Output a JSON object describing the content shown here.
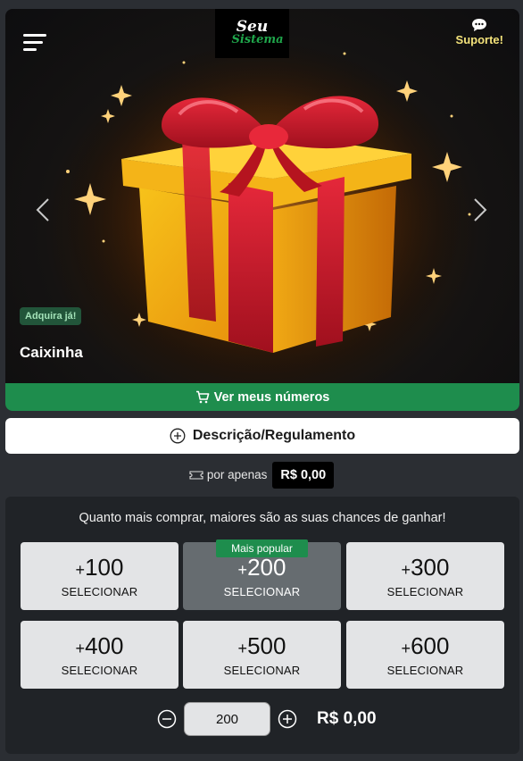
{
  "header": {
    "logo_line1": "Seu",
    "logo_line2": "Sistema",
    "support_label": "Suporte!",
    "menu_icon": "hamburger-icon",
    "support_icon": "chat-bubble-icon"
  },
  "hero": {
    "badge": "Adquira já!",
    "title": "Caixinha",
    "see_numbers_label": "Ver meus números",
    "see_numbers_icon": "cart-icon",
    "image": "gift-box-illustration"
  },
  "description_button": {
    "label": "Descrição/Regulamento",
    "icon": "plus-circle-icon"
  },
  "price": {
    "label": "por apenas",
    "icon": "ticket-icon",
    "value": "R$ 0,00"
  },
  "purchase": {
    "hint": "Quanto mais comprar, maiores são as suas chances de ganhar!",
    "popular_label": "Mais popular",
    "options": [
      {
        "plus": "+",
        "amount": "100",
        "label": "SELECIONAR"
      },
      {
        "plus": "+",
        "amount": "200",
        "label": "SELECIONAR"
      },
      {
        "plus": "+",
        "amount": "300",
        "label": "SELECIONAR"
      },
      {
        "plus": "+",
        "amount": "400",
        "label": "SELECIONAR"
      },
      {
        "plus": "+",
        "amount": "500",
        "label": "SELECIONAR"
      },
      {
        "plus": "+",
        "amount": "600",
        "label": "SELECIONAR"
      }
    ],
    "selected_option": "200",
    "quantity": "200",
    "total": "R$ 0,00"
  },
  "colors": {
    "accent_green": "#1e8d4d",
    "support_yellow": "#f3e27a",
    "panel_bg": "#202327",
    "page_bg": "#2b2e33"
  }
}
